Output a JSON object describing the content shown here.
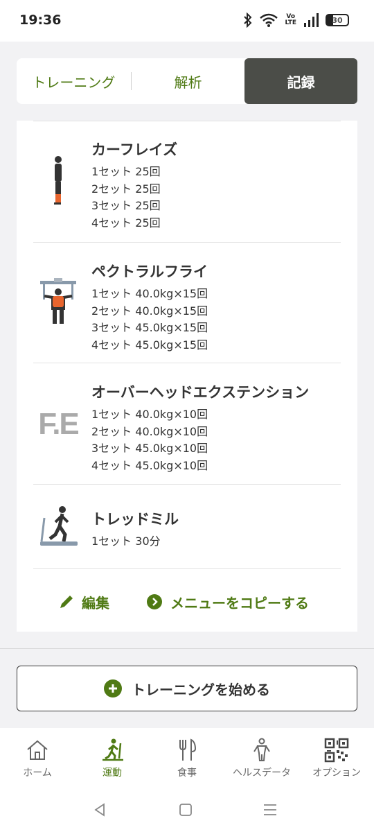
{
  "status": {
    "time": "19:36",
    "volte": "Vo\nLTE",
    "battery": "30"
  },
  "tabs": [
    "トレーニング",
    "解析",
    "記録"
  ],
  "exercises": [
    {
      "title": "カーフレイズ",
      "sets": [
        "1セット 25回",
        "2セット 25回",
        "3セット 25回",
        "4セット 25回"
      ],
      "icon": "calf-raise-icon"
    },
    {
      "title": "ペクトラルフライ",
      "sets": [
        "1セット 40.0kg×15回",
        "2セット 40.0kg×15回",
        "3セット 45.0kg×15回",
        "4セット 45.0kg×15回"
      ],
      "icon": "pec-fly-icon"
    },
    {
      "title": "オーバーヘッドエクステンション",
      "sets": [
        "1セット 40.0kg×10回",
        "2セット 40.0kg×10回",
        "3セット 45.0kg×10回",
        "4セット 45.0kg×10回"
      ],
      "icon": "free-exercise-icon",
      "icon_text": "F.E"
    },
    {
      "title": "トレッドミル",
      "sets": [
        "1セット 30分"
      ],
      "icon": "treadmill-icon"
    }
  ],
  "actions": {
    "edit": "編集",
    "copy": "メニューをコピーする"
  },
  "start_button": "トレーニングを始める",
  "nav": [
    {
      "label": "ホーム",
      "icon": "home-icon",
      "active": false
    },
    {
      "label": "運動",
      "icon": "exercise-icon",
      "active": true
    },
    {
      "label": "食事",
      "icon": "meal-icon",
      "active": false
    },
    {
      "label": "ヘルスデータ",
      "icon": "health-data-icon",
      "active": false
    },
    {
      "label": "オプション",
      "icon": "qr-code-icon",
      "active": false
    }
  ],
  "colors": {
    "accent": "#4f7a14",
    "tab_active_bg": "#4b4d48",
    "muscle_highlight": "#e8652e"
  }
}
